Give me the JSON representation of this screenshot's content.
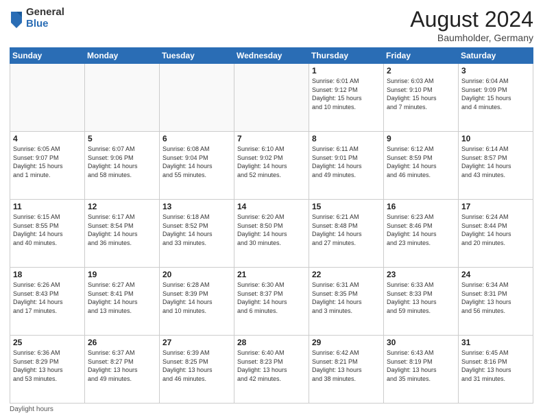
{
  "logo": {
    "general": "General",
    "blue": "Blue"
  },
  "title": {
    "month_year": "August 2024",
    "location": "Baumholder, Germany"
  },
  "days_of_week": [
    "Sunday",
    "Monday",
    "Tuesday",
    "Wednesday",
    "Thursday",
    "Friday",
    "Saturday"
  ],
  "weeks": [
    [
      {
        "day": "",
        "info": ""
      },
      {
        "day": "",
        "info": ""
      },
      {
        "day": "",
        "info": ""
      },
      {
        "day": "",
        "info": ""
      },
      {
        "day": "1",
        "info": "Sunrise: 6:01 AM\nSunset: 9:12 PM\nDaylight: 15 hours\nand 10 minutes."
      },
      {
        "day": "2",
        "info": "Sunrise: 6:03 AM\nSunset: 9:10 PM\nDaylight: 15 hours\nand 7 minutes."
      },
      {
        "day": "3",
        "info": "Sunrise: 6:04 AM\nSunset: 9:09 PM\nDaylight: 15 hours\nand 4 minutes."
      }
    ],
    [
      {
        "day": "4",
        "info": "Sunrise: 6:05 AM\nSunset: 9:07 PM\nDaylight: 15 hours\nand 1 minute."
      },
      {
        "day": "5",
        "info": "Sunrise: 6:07 AM\nSunset: 9:06 PM\nDaylight: 14 hours\nand 58 minutes."
      },
      {
        "day": "6",
        "info": "Sunrise: 6:08 AM\nSunset: 9:04 PM\nDaylight: 14 hours\nand 55 minutes."
      },
      {
        "day": "7",
        "info": "Sunrise: 6:10 AM\nSunset: 9:02 PM\nDaylight: 14 hours\nand 52 minutes."
      },
      {
        "day": "8",
        "info": "Sunrise: 6:11 AM\nSunset: 9:01 PM\nDaylight: 14 hours\nand 49 minutes."
      },
      {
        "day": "9",
        "info": "Sunrise: 6:12 AM\nSunset: 8:59 PM\nDaylight: 14 hours\nand 46 minutes."
      },
      {
        "day": "10",
        "info": "Sunrise: 6:14 AM\nSunset: 8:57 PM\nDaylight: 14 hours\nand 43 minutes."
      }
    ],
    [
      {
        "day": "11",
        "info": "Sunrise: 6:15 AM\nSunset: 8:55 PM\nDaylight: 14 hours\nand 40 minutes."
      },
      {
        "day": "12",
        "info": "Sunrise: 6:17 AM\nSunset: 8:54 PM\nDaylight: 14 hours\nand 36 minutes."
      },
      {
        "day": "13",
        "info": "Sunrise: 6:18 AM\nSunset: 8:52 PM\nDaylight: 14 hours\nand 33 minutes."
      },
      {
        "day": "14",
        "info": "Sunrise: 6:20 AM\nSunset: 8:50 PM\nDaylight: 14 hours\nand 30 minutes."
      },
      {
        "day": "15",
        "info": "Sunrise: 6:21 AM\nSunset: 8:48 PM\nDaylight: 14 hours\nand 27 minutes."
      },
      {
        "day": "16",
        "info": "Sunrise: 6:23 AM\nSunset: 8:46 PM\nDaylight: 14 hours\nand 23 minutes."
      },
      {
        "day": "17",
        "info": "Sunrise: 6:24 AM\nSunset: 8:44 PM\nDaylight: 14 hours\nand 20 minutes."
      }
    ],
    [
      {
        "day": "18",
        "info": "Sunrise: 6:26 AM\nSunset: 8:43 PM\nDaylight: 14 hours\nand 17 minutes."
      },
      {
        "day": "19",
        "info": "Sunrise: 6:27 AM\nSunset: 8:41 PM\nDaylight: 14 hours\nand 13 minutes."
      },
      {
        "day": "20",
        "info": "Sunrise: 6:28 AM\nSunset: 8:39 PM\nDaylight: 14 hours\nand 10 minutes."
      },
      {
        "day": "21",
        "info": "Sunrise: 6:30 AM\nSunset: 8:37 PM\nDaylight: 14 hours\nand 6 minutes."
      },
      {
        "day": "22",
        "info": "Sunrise: 6:31 AM\nSunset: 8:35 PM\nDaylight: 14 hours\nand 3 minutes."
      },
      {
        "day": "23",
        "info": "Sunrise: 6:33 AM\nSunset: 8:33 PM\nDaylight: 13 hours\nand 59 minutes."
      },
      {
        "day": "24",
        "info": "Sunrise: 6:34 AM\nSunset: 8:31 PM\nDaylight: 13 hours\nand 56 minutes."
      }
    ],
    [
      {
        "day": "25",
        "info": "Sunrise: 6:36 AM\nSunset: 8:29 PM\nDaylight: 13 hours\nand 53 minutes."
      },
      {
        "day": "26",
        "info": "Sunrise: 6:37 AM\nSunset: 8:27 PM\nDaylight: 13 hours\nand 49 minutes."
      },
      {
        "day": "27",
        "info": "Sunrise: 6:39 AM\nSunset: 8:25 PM\nDaylight: 13 hours\nand 46 minutes."
      },
      {
        "day": "28",
        "info": "Sunrise: 6:40 AM\nSunset: 8:23 PM\nDaylight: 13 hours\nand 42 minutes."
      },
      {
        "day": "29",
        "info": "Sunrise: 6:42 AM\nSunset: 8:21 PM\nDaylight: 13 hours\nand 38 minutes."
      },
      {
        "day": "30",
        "info": "Sunrise: 6:43 AM\nSunset: 8:19 PM\nDaylight: 13 hours\nand 35 minutes."
      },
      {
        "day": "31",
        "info": "Sunrise: 6:45 AM\nSunset: 8:16 PM\nDaylight: 13 hours\nand 31 minutes."
      }
    ]
  ],
  "footer": {
    "daylight_hours": "Daylight hours"
  }
}
